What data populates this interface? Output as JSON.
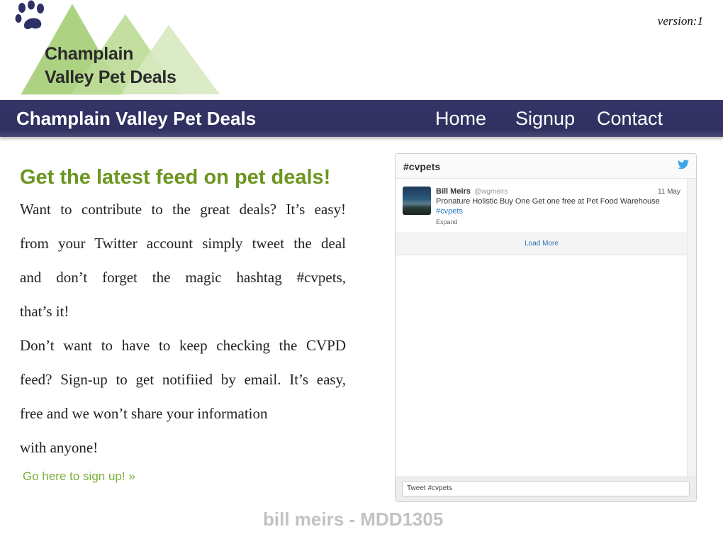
{
  "logo": {
    "line1": "Champlain",
    "line2": "Valley Pet Deals",
    "icon": "paw-icon",
    "mountain_colors": [
      "#a8d07a",
      "#c3de9e",
      "#d9ebc4"
    ]
  },
  "version": "version:1",
  "navbar": {
    "title": "Champlain Valley Pet Deals",
    "links": [
      "Home",
      "Signup",
      "Contact"
    ],
    "background": "#333366"
  },
  "main": {
    "headline": "Get the latest feed on pet deals!",
    "headline_color": "#6b9620",
    "paragraph_lines": [
      "Want to contribute to the great deals? It’s easy!",
      "from your Twitter account simply tweet the deal",
      "and don’t forget the magic hashtag #cvpets,",
      "that’s it!",
      "Don’t want to have to keep checking the CVPD",
      "feed? Sign-up to get notifiied by email. It’s easy,",
      "free and we won’t share your information",
      "with anyone!"
    ],
    "signup_link": "Go here to sign up! »"
  },
  "twitter_widget": {
    "title": "#cvpets",
    "icon": "twitter-bird-icon",
    "tweet": {
      "author": "Bill Meirs",
      "handle": "@wgmeirs",
      "date": "11 May",
      "text": "Pronature Holistic Buy One Get one free at Pet Food Warehouse",
      "hashtag": "#cvpets",
      "expand": "Expand"
    },
    "load_more": "Load More",
    "input_value": "Tweet #cvpets"
  },
  "footer": {
    "credit": "bill meirs - MDD1305"
  }
}
